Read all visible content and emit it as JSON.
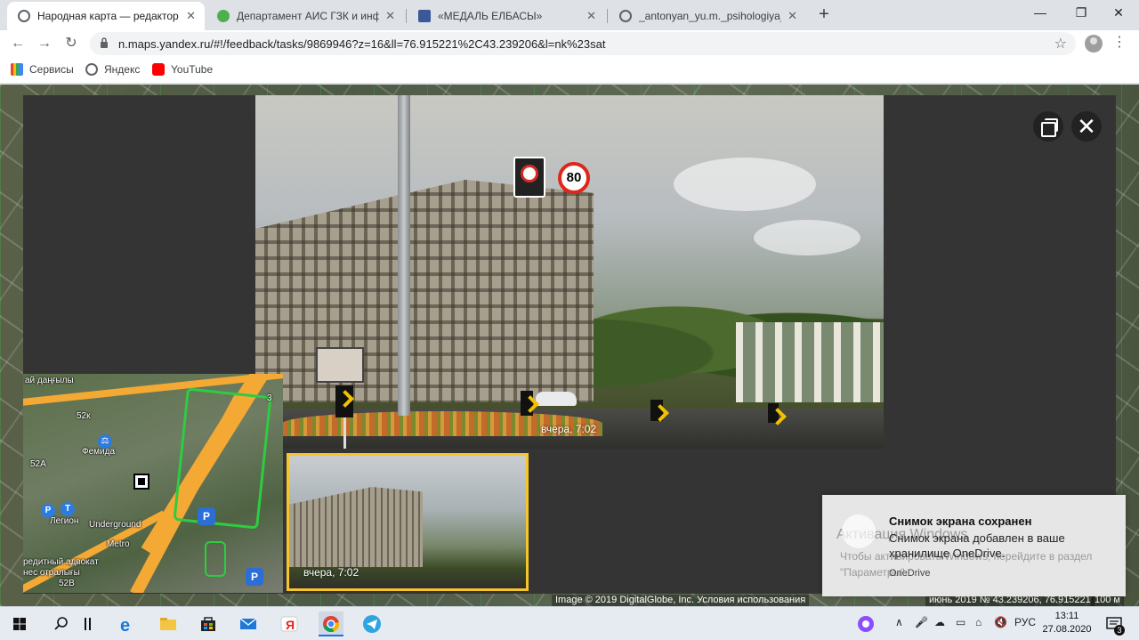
{
  "browser": {
    "tabs": [
      {
        "label": "Народная карта — редактор Ян",
        "active": true
      },
      {
        "label": "Департамент АИС ГЗК и инфор",
        "active": false
      },
      {
        "label": "«МЕДАЛЬ ЕЛБАСЫ»",
        "active": false
      },
      {
        "label": "_antonyan_yu.m._psihologiya_pre",
        "active": false
      }
    ],
    "new_tab": "+",
    "window_controls": {
      "minimize": "—",
      "maximize": "❐",
      "close": "✕"
    },
    "url": "n.maps.yandex.ru/#!/feedback/tasks/9869946?z=16&ll=76.915221%2C43.239206&l=nk%23sat",
    "bookmarks": [
      {
        "label": "Сервисы"
      },
      {
        "label": "Яндекс"
      },
      {
        "label": "YouTube"
      }
    ]
  },
  "viewer": {
    "main_photo_time": "вчера, 7:02",
    "speed_limit": "80",
    "thumbnail_time": "вчера, 7:02",
    "minimap": {
      "labels": [
        "ай даңғылы",
        "52к",
        "Фемида",
        "52А",
        "Легион",
        "Underground",
        "Metro",
        "редитный адвокат",
        "нес отралығы",
        "52В",
        "3"
      ],
      "parking": "P"
    }
  },
  "map_footer": {
    "copyright": "Image © 2019 DigitalGlobe, Inc. Условия использования",
    "coords": "июнь 2019 № 43.239206, 76.915221",
    "scale": "100 м"
  },
  "notification": {
    "ghost_title": "Активация Windows",
    "ghost_body": "Чтобы активировать Windows, перейдите в раздел \"Параметры\".",
    "title": "Снимок экрана сохранен",
    "body": "Снимок экрана добавлен в ваше хранилище OneDrive.",
    "source": "OneDrive"
  },
  "taskbar": {
    "language": "РУС",
    "time": "13:11",
    "date": "27.08.2020",
    "notification_count": "3"
  },
  "colors": {
    "thumb_border": "#f7c52a",
    "speed_border": "#e0261a",
    "chrome_bg": "#dee1e6"
  }
}
